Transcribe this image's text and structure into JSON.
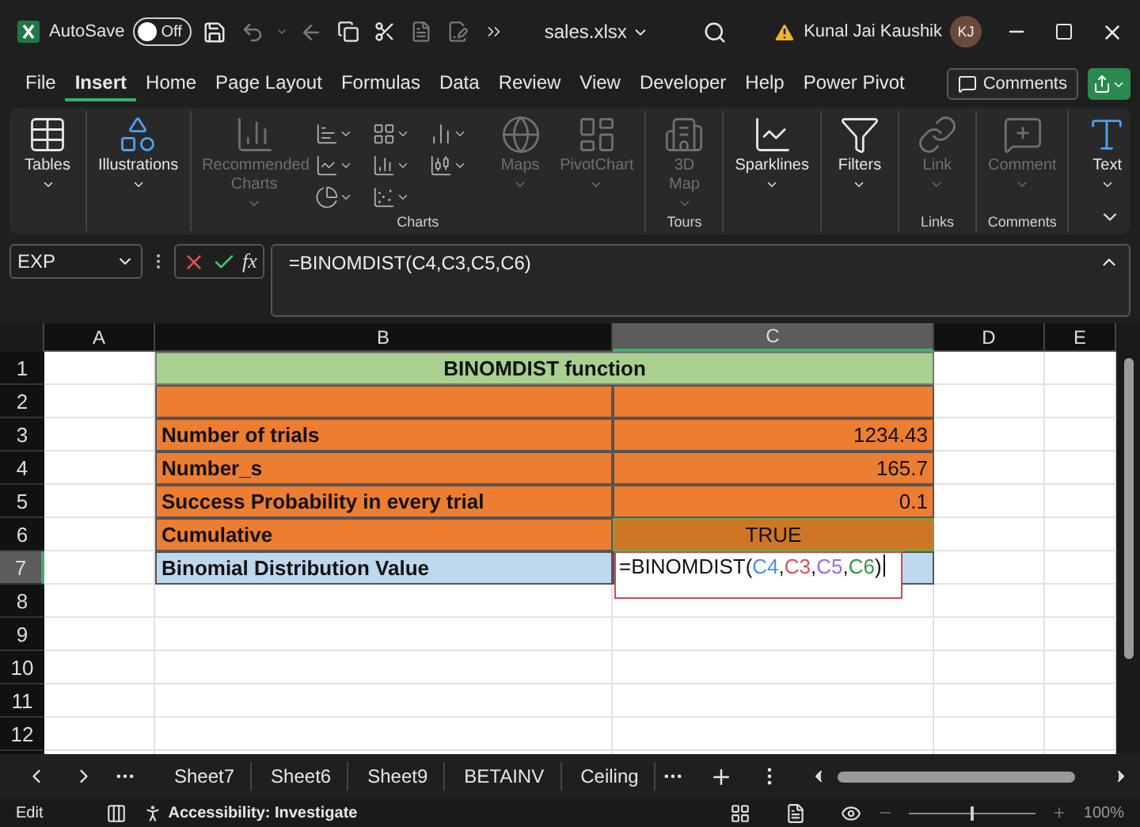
{
  "title_bar": {
    "autosave_label": "AutoSave",
    "autosave": {
      "on": false,
      "label": "Off"
    },
    "file_name": "sales.xlsx",
    "user_name": "Kunal Jai Kaushik",
    "user_initials": "KJ"
  },
  "menu_tabs": [
    {
      "label": "File",
      "selected": false
    },
    {
      "label": "Insert",
      "selected": true
    },
    {
      "label": "Home",
      "selected": false
    },
    {
      "label": "Page Layout",
      "selected": false
    },
    {
      "label": "Formulas",
      "selected": false
    },
    {
      "label": "Data",
      "selected": false
    },
    {
      "label": "Review",
      "selected": false
    },
    {
      "label": "View",
      "selected": false
    },
    {
      "label": "Developer",
      "selected": false
    },
    {
      "label": "Help",
      "selected": false
    },
    {
      "label": "Power Pivot",
      "selected": false
    }
  ],
  "comments_button": "Comments",
  "ribbon_groups": [
    {
      "buttons": [
        {
          "label": "Tables",
          "kind": "tables",
          "disabled": false
        }
      ]
    },
    {
      "buttons": [
        {
          "label": "Illustrations",
          "kind": "illustrations",
          "disabled": false
        }
      ]
    },
    {
      "label": "Charts",
      "buttons": [
        {
          "label": "Recommended Charts",
          "kind": "recommended",
          "disabled": true
        },
        {
          "kind": "chart-grid",
          "disabled": false
        },
        {
          "label": "Maps",
          "kind": "maps",
          "disabled": true
        },
        {
          "label": "PivotChart",
          "kind": "pivotchart",
          "disabled": true
        }
      ]
    },
    {
      "label": "Tours",
      "buttons": [
        {
          "label": "3D Map",
          "kind": "map3d",
          "disabled": true
        }
      ]
    },
    {
      "buttons": [
        {
          "label": "Sparklines",
          "kind": "sparklines",
          "disabled": false
        }
      ]
    },
    {
      "buttons": [
        {
          "label": "Filters",
          "kind": "filters",
          "disabled": false
        }
      ]
    },
    {
      "label": "Links",
      "buttons": [
        {
          "label": "Link",
          "kind": "link",
          "disabled": true
        }
      ]
    },
    {
      "label": "Comments",
      "buttons": [
        {
          "label": "Comment",
          "kind": "comment",
          "disabled": true
        }
      ]
    },
    {
      "buttons": [
        {
          "label": "Text",
          "kind": "text",
          "disabled": false
        }
      ]
    }
  ],
  "formula_bar": {
    "name_box": "EXP",
    "function_label": "fx",
    "formula": "=BINOMDIST(C4,C3,C5,C6)"
  },
  "columns": [
    {
      "label": "A",
      "selected": false
    },
    {
      "label": "B",
      "selected": false
    },
    {
      "label": "C",
      "selected": true
    },
    {
      "label": "D",
      "selected": false
    },
    {
      "label": "E",
      "selected": false
    }
  ],
  "rows": [
    {
      "number": "1",
      "selected": false,
      "cells": [
        {
          "kind": "plain"
        },
        {
          "kind": "title",
          "text": "BINOMDIST function"
        },
        {
          "kind": "plain"
        },
        {
          "kind": "plain"
        }
      ]
    },
    {
      "number": "2",
      "selected": false,
      "cells": [
        {
          "kind": "plain"
        },
        {
          "kind": "label"
        },
        {
          "kind": "value"
        },
        {
          "kind": "plain"
        },
        {
          "kind": "plain"
        }
      ]
    },
    {
      "number": "3",
      "selected": false,
      "cells": [
        {
          "kind": "plain"
        },
        {
          "kind": "label",
          "text": "Number of trials"
        },
        {
          "kind": "value",
          "text": "1234.43"
        },
        {
          "kind": "plain"
        },
        {
          "kind": "plain"
        }
      ]
    },
    {
      "number": "4",
      "selected": false,
      "cells": [
        {
          "kind": "plain"
        },
        {
          "kind": "label",
          "text": "Number_s"
        },
        {
          "kind": "value",
          "text": "165.7"
        },
        {
          "kind": "plain"
        },
        {
          "kind": "plain"
        }
      ]
    },
    {
      "number": "5",
      "selected": false,
      "cells": [
        {
          "kind": "plain"
        },
        {
          "kind": "label",
          "text": "Success Probability in every trial"
        },
        {
          "kind": "value",
          "text": "0.1"
        },
        {
          "kind": "plain"
        },
        {
          "kind": "plain"
        }
      ]
    },
    {
      "number": "6",
      "selected": false,
      "cells": [
        {
          "kind": "plain"
        },
        {
          "kind": "label",
          "text": "Cumulative"
        },
        {
          "kind": "flag",
          "text": "TRUE"
        },
        {
          "kind": "plain"
        },
        {
          "kind": "plain"
        }
      ]
    },
    {
      "number": "7",
      "selected": true,
      "cells": [
        {
          "kind": "plain"
        },
        {
          "kind": "result",
          "text": "Binomial Distribution Value"
        },
        {
          "kind": "editing",
          "parts": [
            {
              "text": "=BINOMDIST("
            },
            {
              "text": "C4",
              "color": "#4f8fe6",
              "after": ","
            },
            {
              "text": "C3",
              "color": "#e0505a",
              "after": ","
            },
            {
              "text": "C5",
              "color": "#9a6fe0",
              "after": ","
            },
            {
              "text": "C6",
              "color": "#2e9a4a",
              "after": ")"
            }
          ]
        },
        {
          "kind": "plain"
        },
        {
          "kind": "plain"
        }
      ]
    },
    {
      "number": "8",
      "selected": false,
      "cells": [
        {
          "kind": "plain"
        },
        {
          "kind": "plain"
        },
        {
          "kind": "plain"
        },
        {
          "kind": "plain"
        },
        {
          "kind": "plain"
        }
      ]
    },
    {
      "number": "9",
      "selected": false,
      "cells": [
        {
          "kind": "plain"
        },
        {
          "kind": "plain"
        },
        {
          "kind": "plain"
        },
        {
          "kind": "plain"
        },
        {
          "kind": "plain"
        }
      ]
    },
    {
      "number": "10",
      "selected": false,
      "cells": [
        {
          "kind": "plain"
        },
        {
          "kind": "plain"
        },
        {
          "kind": "plain"
        },
        {
          "kind": "plain"
        },
        {
          "kind": "plain"
        }
      ]
    },
    {
      "number": "11",
      "selected": false,
      "cells": [
        {
          "kind": "plain"
        },
        {
          "kind": "plain"
        },
        {
          "kind": "plain"
        },
        {
          "kind": "plain"
        },
        {
          "kind": "plain"
        }
      ]
    },
    {
      "number": "12",
      "selected": false,
      "cells": [
        {
          "kind": "plain"
        },
        {
          "kind": "plain"
        },
        {
          "kind": "plain"
        },
        {
          "kind": "plain"
        },
        {
          "kind": "plain"
        }
      ]
    }
  ],
  "sheet_tabs": [
    {
      "label": "Sheet7",
      "selected": false
    },
    {
      "label": "Sheet6",
      "selected": false
    },
    {
      "label": "Sheet9",
      "selected": false
    },
    {
      "label": "BETAINV",
      "selected": false
    },
    {
      "label": "Ceiling",
      "selected": false
    }
  ],
  "status_bar": {
    "mode": "Edit",
    "accessibility": "Accessibility: Investigate",
    "zoom_slider": {
      "level": 0.5
    },
    "zoom": "100%"
  }
}
